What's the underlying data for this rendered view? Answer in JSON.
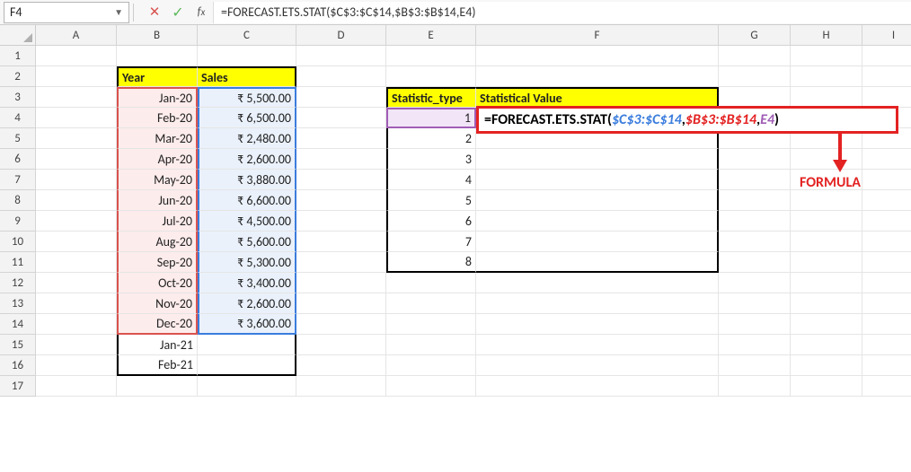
{
  "name_box": "F4",
  "formula_bar": "=FORECAST.ETS.STAT($C$3:$C$14,$B$3:$B$14,E4)",
  "in_cell_tokens": {
    "fn": "=FORECAST.ETS.STAT(",
    "arg1": "$C$3:$C$14",
    "sep1": ",",
    "arg2": "$B$3:$B$14",
    "sep2": ",",
    "arg3": "E4",
    "close": ")"
  },
  "colhdrs": [
    "A",
    "B",
    "C",
    "D",
    "E",
    "F",
    "G",
    "H",
    "I"
  ],
  "rowhdrs": [
    "1",
    "2",
    "3",
    "4",
    "5",
    "6",
    "7",
    "8",
    "9",
    "10",
    "11",
    "12",
    "13",
    "14",
    "15",
    "16",
    "17"
  ],
  "tableAB": {
    "hdr_year": "Year",
    "hdr_sales": "Sales",
    "rows": [
      {
        "year": "Jan-20",
        "sales": "₹ 5,500.00"
      },
      {
        "year": "Feb-20",
        "sales": "₹ 6,500.00"
      },
      {
        "year": "Mar-20",
        "sales": "₹ 2,480.00"
      },
      {
        "year": "Apr-20",
        "sales": "₹ 2,600.00"
      },
      {
        "year": "May-20",
        "sales": "₹ 3,880.00"
      },
      {
        "year": "Jun-20",
        "sales": "₹ 6,600.00"
      },
      {
        "year": "Jul-20",
        "sales": "₹ 4,500.00"
      },
      {
        "year": "Aug-20",
        "sales": "₹ 5,600.00"
      },
      {
        "year": "Sep-20",
        "sales": "₹ 5,300.00"
      },
      {
        "year": "Oct-20",
        "sales": "₹ 3,400.00"
      },
      {
        "year": "Nov-20",
        "sales": "₹ 2,600.00"
      },
      {
        "year": "Dec-20",
        "sales": "₹ 3,600.00"
      },
      {
        "year": "Jan-21",
        "sales": ""
      },
      {
        "year": "Feb-21",
        "sales": ""
      }
    ]
  },
  "tableEF": {
    "hdr_stype": "Statistic_type",
    "hdr_sval": "Statistical Value",
    "erows": [
      "1",
      "2",
      "3",
      "4",
      "5",
      "6",
      "7",
      "8"
    ]
  },
  "annotation": "FORMULA"
}
